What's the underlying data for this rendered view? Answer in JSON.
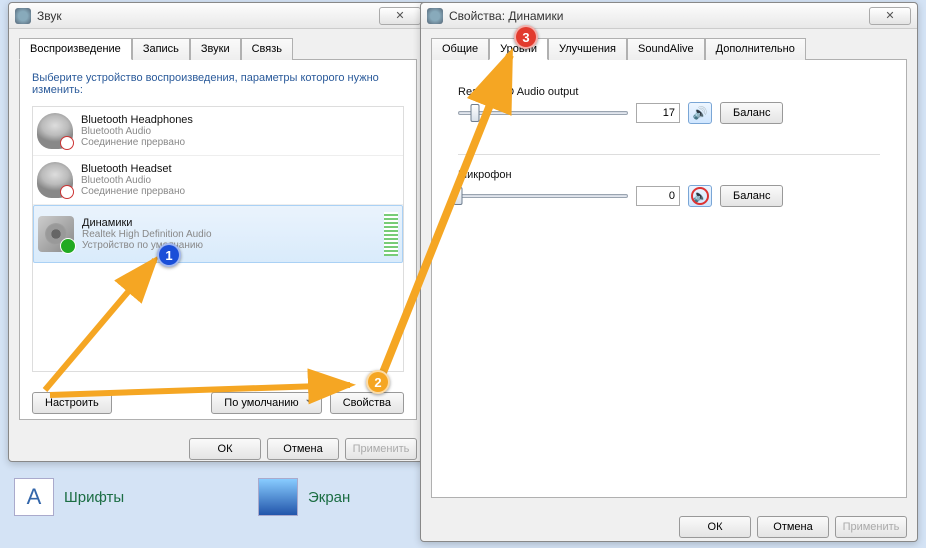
{
  "soundWindow": {
    "title": "Звук",
    "tabs": [
      "Воспроизведение",
      "Запись",
      "Звуки",
      "Связь"
    ],
    "activeTab": 0,
    "helpText": "Выберите устройство воспроизведения, параметры которого нужно изменить:",
    "devices": [
      {
        "name": "Bluetooth Headphones",
        "sub": "Bluetooth Audio",
        "status": "Соединение прервано"
      },
      {
        "name": "Bluetooth Headset",
        "sub": "Bluetooth Audio",
        "status": "Соединение прервано"
      },
      {
        "name": "Динамики",
        "sub": "Realtek High Definition Audio",
        "status": "Устройство по умолчанию"
      }
    ],
    "configureBtn": "Настроить",
    "defaultBtn": "По умолчанию",
    "propertiesBtn": "Свойства",
    "ok": "ОК",
    "cancel": "Отмена",
    "apply": "Применить"
  },
  "propWindow": {
    "title": "Свойства: Динамики",
    "tabs": [
      "Общие",
      "Уровни",
      "Улучшения",
      "SoundAlive",
      "Дополнительно"
    ],
    "activeTab": 1,
    "section1": {
      "label": "Realtek HD Audio output",
      "value": "17",
      "sliderPos": 10,
      "balanceBtn": "Баланс"
    },
    "section2": {
      "label": "Микрофон",
      "value": "0",
      "sliderPos": 0,
      "balanceBtn": "Баланс"
    },
    "ok": "ОК",
    "cancel": "Отмена",
    "apply": "Применить"
  },
  "desktop": {
    "fonts": "Шрифты",
    "display": "Экран"
  },
  "annotations": {
    "b1": "1",
    "b2": "2",
    "b3": "3"
  }
}
